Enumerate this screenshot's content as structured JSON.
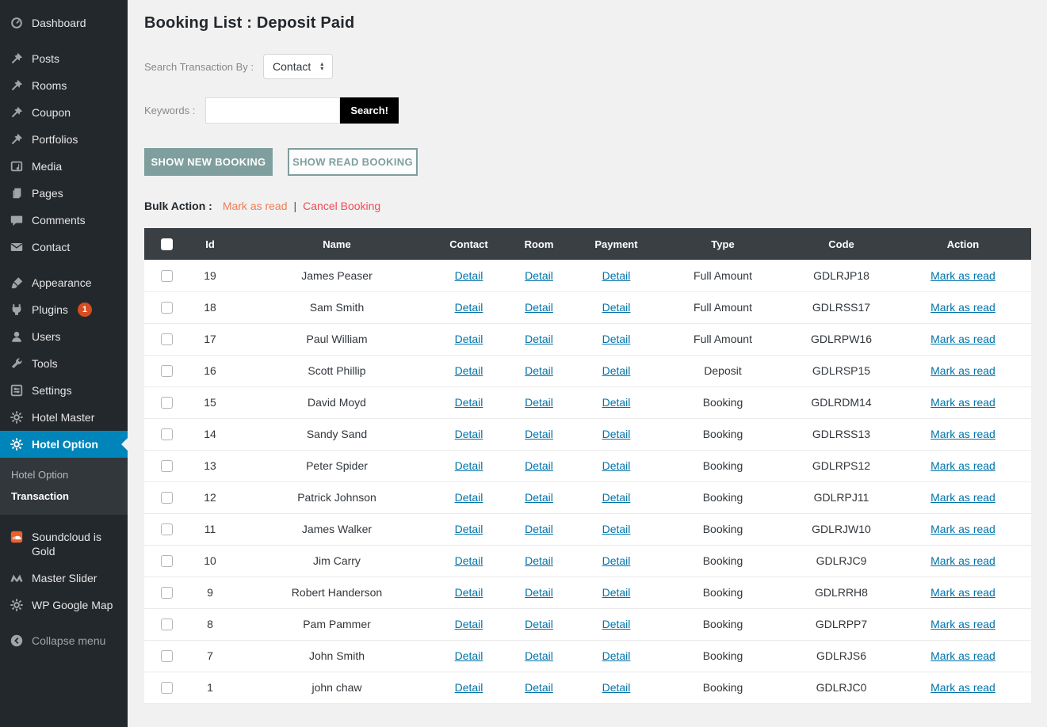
{
  "colors": {
    "sidebar_bg": "#23282d",
    "submenu_bg": "#32373c",
    "active_item_bg": "#0085ba",
    "badge_bg": "#d54e21",
    "table_header_bg": "#3a3f44",
    "link_blue": "#0073aa",
    "bulk_orange": "#ef7c54",
    "bulk_red": "#f04b55",
    "button_sage": "#7f9e9e",
    "search_button_black": "#000000",
    "content_bg": "#f1f1f1"
  },
  "sidebar": {
    "groups": [
      {
        "items": [
          {
            "label": "Dashboard",
            "icon": "dashboard-icon"
          }
        ]
      },
      {
        "items": [
          {
            "label": "Posts",
            "icon": "pin-icon"
          },
          {
            "label": "Rooms",
            "icon": "pin-icon"
          },
          {
            "label": "Coupon",
            "icon": "pin-icon"
          },
          {
            "label": "Portfolios",
            "icon": "pin-icon"
          },
          {
            "label": "Media",
            "icon": "media-icon"
          },
          {
            "label": "Pages",
            "icon": "pages-icon"
          },
          {
            "label": "Comments",
            "icon": "comment-icon"
          },
          {
            "label": "Contact",
            "icon": "envelope-icon"
          }
        ]
      },
      {
        "items": [
          {
            "label": "Appearance",
            "icon": "brush-icon"
          },
          {
            "label": "Plugins",
            "icon": "plug-icon",
            "badge": "1"
          },
          {
            "label": "Users",
            "icon": "user-icon"
          },
          {
            "label": "Tools",
            "icon": "wrench-icon"
          },
          {
            "label": "Settings",
            "icon": "sliders-icon"
          },
          {
            "label": "Hotel Master",
            "icon": "gear-icon"
          },
          {
            "label": "Hotel Option",
            "icon": "gear-icon",
            "active": true,
            "submenu": [
              {
                "label": "Hotel Option"
              },
              {
                "label": "Transaction",
                "current": true
              }
            ]
          }
        ]
      },
      {
        "items": [
          {
            "label": "Soundcloud is Gold",
            "icon": "soundcloud-icon"
          },
          {
            "label": "Master Slider",
            "icon": "masterslider-icon"
          },
          {
            "label": "WP Google Map",
            "icon": "gear-icon"
          }
        ]
      },
      {
        "items": [
          {
            "label": "Collapse menu",
            "icon": "collapse-icon",
            "muted": true
          }
        ]
      }
    ]
  },
  "main": {
    "title": "Booking List : Deposit Paid",
    "search_by": {
      "label": "Search Transaction By :",
      "selected": "Contact"
    },
    "keywords": {
      "label": "Keywords :",
      "value": "",
      "button": "Search!"
    },
    "toggle_buttons": {
      "show_new": "SHOW NEW BOOKING",
      "show_read": "SHOW READ BOOKING"
    },
    "bulk_action": {
      "label": "Bulk Action :",
      "mark_as_read": "Mark as read",
      "separator": "|",
      "cancel_booking": "Cancel Booking"
    },
    "table": {
      "headers": [
        "Id",
        "Name",
        "Contact",
        "Room",
        "Payment",
        "Type",
        "Code",
        "Action"
      ],
      "detail_link_label": "Detail",
      "action_link_label": "Mark as read",
      "rows": [
        {
          "id": "19",
          "name": "James Peaser",
          "contact": "Detail",
          "room": "Detail",
          "payment": "Detail",
          "type": "Full Amount",
          "code": "GDLRJP18",
          "action": "Mark as read"
        },
        {
          "id": "18",
          "name": "Sam Smith",
          "contact": "Detail",
          "room": "Detail",
          "payment": "Detail",
          "type": "Full Amount",
          "code": "GDLRSS17",
          "action": "Mark as read"
        },
        {
          "id": "17",
          "name": "Paul William",
          "contact": "Detail",
          "room": "Detail",
          "payment": "Detail",
          "type": "Full Amount",
          "code": "GDLRPW16",
          "action": "Mark as read"
        },
        {
          "id": "16",
          "name": "Scott Phillip",
          "contact": "Detail",
          "room": "Detail",
          "payment": "Detail",
          "type": "Deposit",
          "code": "GDLRSP15",
          "action": "Mark as read"
        },
        {
          "id": "15",
          "name": "David Moyd",
          "contact": "Detail",
          "room": "Detail",
          "payment": "Detail",
          "type": "Booking",
          "code": "GDLRDM14",
          "action": "Mark as read"
        },
        {
          "id": "14",
          "name": "Sandy Sand",
          "contact": "Detail",
          "room": "Detail",
          "payment": "Detail",
          "type": "Booking",
          "code": "GDLRSS13",
          "action": "Mark as read"
        },
        {
          "id": "13",
          "name": "Peter Spider",
          "contact": "Detail",
          "room": "Detail",
          "payment": "Detail",
          "type": "Booking",
          "code": "GDLRPS12",
          "action": "Mark as read"
        },
        {
          "id": "12",
          "name": "Patrick Johnson",
          "contact": "Detail",
          "room": "Detail",
          "payment": "Detail",
          "type": "Booking",
          "code": "GDLRPJ11",
          "action": "Mark as read"
        },
        {
          "id": "11",
          "name": "James Walker",
          "contact": "Detail",
          "room": "Detail",
          "payment": "Detail",
          "type": "Booking",
          "code": "GDLRJW10",
          "action": "Mark as read"
        },
        {
          "id": "10",
          "name": "Jim Carry",
          "contact": "Detail",
          "room": "Detail",
          "payment": "Detail",
          "type": "Booking",
          "code": "GDLRJC9",
          "action": "Mark as read"
        },
        {
          "id": "9",
          "name": "Robert Handerson",
          "contact": "Detail",
          "room": "Detail",
          "payment": "Detail",
          "type": "Booking",
          "code": "GDLRRH8",
          "action": "Mark as read"
        },
        {
          "id": "8",
          "name": "Pam Pammer",
          "contact": "Detail",
          "room": "Detail",
          "payment": "Detail",
          "type": "Booking",
          "code": "GDLRPP7",
          "action": "Mark as read"
        },
        {
          "id": "7",
          "name": "John Smith",
          "contact": "Detail",
          "room": "Detail",
          "payment": "Detail",
          "type": "Booking",
          "code": "GDLRJS6",
          "action": "Mark as read"
        },
        {
          "id": "1",
          "name": "john chaw",
          "contact": "Detail",
          "room": "Detail",
          "payment": "Detail",
          "type": "Booking",
          "code": "GDLRJC0",
          "action": "Mark as read"
        }
      ]
    }
  }
}
